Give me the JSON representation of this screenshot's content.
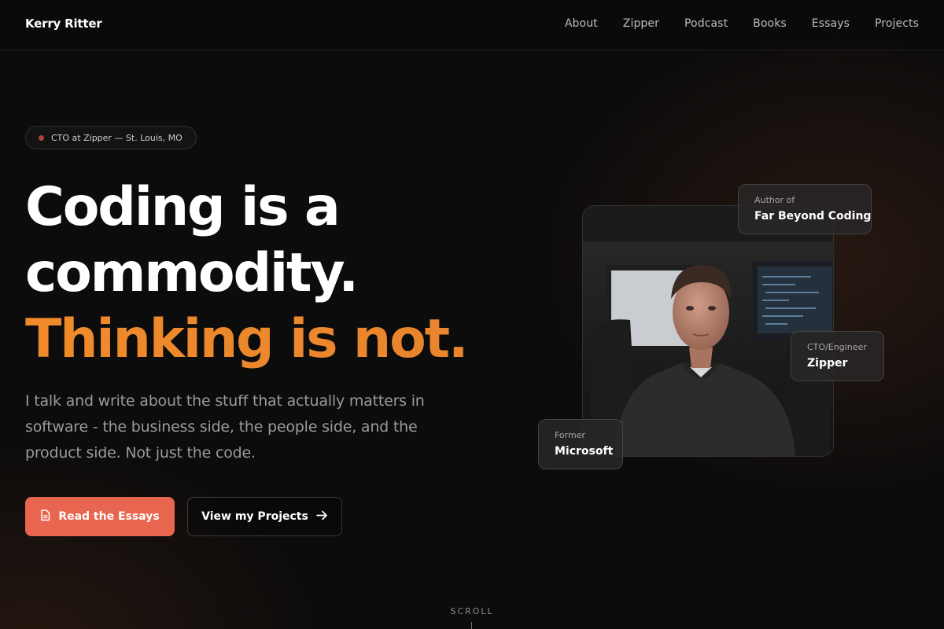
{
  "header": {
    "brand": "Kerry Ritter",
    "nav": [
      "About",
      "Zipper",
      "Podcast",
      "Books",
      "Essays",
      "Projects"
    ]
  },
  "hero": {
    "badge": "CTO at Zipper — St. Louis, MO",
    "headline_lines": [
      "Coding is a",
      "commodity."
    ],
    "headline_accent": "Thinking is not.",
    "subtext": "I talk and write about the stuff that actually matters in software - the business side, the people side, and the product side. Not just the code.",
    "primary_button": "Read the Essays",
    "secondary_button": "View my Projects"
  },
  "cards": {
    "author": {
      "title": "Author of",
      "value": "Far Beyond Coding"
    },
    "cto": {
      "title": "CTO/Engineer",
      "value": "Zipper"
    },
    "former": {
      "title": "Former",
      "value": "Microsoft"
    }
  },
  "scroll_label": "SCROLL",
  "colors": {
    "accent_orange": "#f08a2b",
    "primary_button": "#e8654f",
    "badge_dot": "#b2433a",
    "background": "#0d0c0c"
  },
  "icons": {
    "primary_button": "document-icon",
    "secondary_button": "arrow-right-icon"
  }
}
